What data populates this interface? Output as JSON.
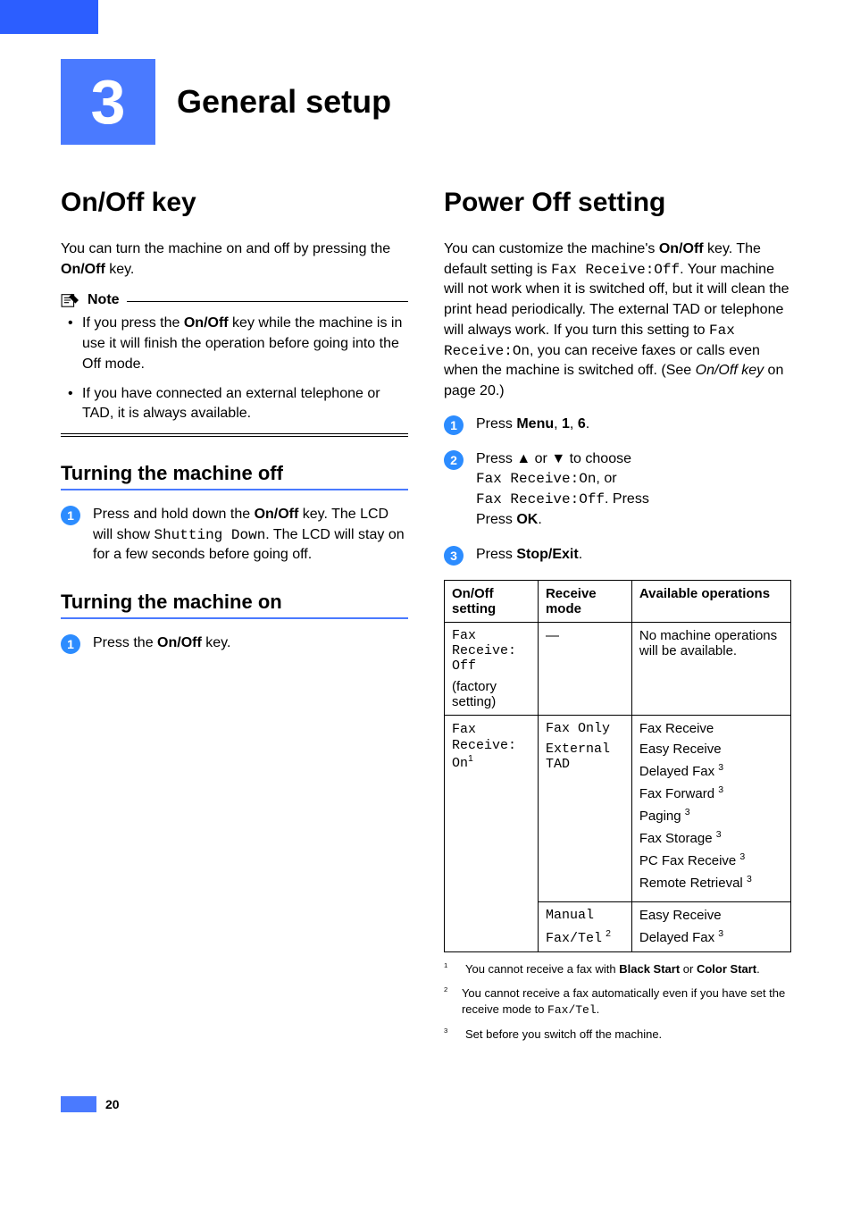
{
  "chapter": {
    "number": "3",
    "title": "General setup"
  },
  "left": {
    "h1": "On/Off key",
    "intro_pre": "You can turn the machine on and off by pressing the ",
    "intro_bold": "On/Off",
    "intro_post": " key.",
    "note_label": "Note",
    "note_items": {
      "a_pre": "If you press the ",
      "a_bold": "On/Off",
      "a_post": " key while the machine is in use it will finish the operation before going into the Off mode.",
      "b": "If you have connected an external telephone or TAD, it is always available."
    },
    "sub_off": "Turning the machine off",
    "off_step_pre": "Press and hold down the ",
    "off_step_bold": "On/Off",
    "off_step_mid": " key. The LCD will show ",
    "off_step_mono": "Shutting Down",
    "off_step_post": ". The LCD will stay on for a few seconds before going off.",
    "sub_on": "Turning the machine on",
    "on_step_pre": "Press the ",
    "on_step_bold": "On/Off",
    "on_step_post": " key."
  },
  "right": {
    "h1": "Power Off setting",
    "p1_a": "You can customize the machine's ",
    "p1_b": "On/Off",
    "p1_c": " key. The default setting is ",
    "p1_d": "Fax Receive:Off",
    "p1_e": ". Your machine will not work when it is switched off, but it will clean the print head periodically. The external TAD or telephone will always work. If you turn this setting to ",
    "p1_f": "Fax Receive:On",
    "p1_g": ", you can receive faxes or calls even when the machine is switched off. (See ",
    "p1_h": "On/Off key",
    "p1_i": " on page 20.)",
    "step1_a": "Press ",
    "step1_b": "Menu",
    "step1_c": ", ",
    "step1_d": "1",
    "step1_e": ", ",
    "step1_f": "6",
    "step1_g": ".",
    "step2_a": "Press ",
    "step2_tri1": "▲",
    "step2_b": " or ",
    "step2_tri2": "▼",
    "step2_c": " to choose ",
    "step2_d": "Fax Receive:On",
    "step2_e": ", or ",
    "step2_f": "Fax Receive:Off",
    "step2_g": ". Press ",
    "step2_h": "OK",
    "step2_i": ".",
    "step3_a": "Press ",
    "step3_b": "Stop/Exit",
    "step3_c": ".",
    "table": {
      "h1": "On/Off setting",
      "h2": "Receive mode",
      "h3": "Available operations",
      "r1c1a": "Fax Receive:",
      "r1c1b": "Off",
      "r1c1c": "(factory setting)",
      "r1c2": "—",
      "r1c3": "No machine operations will be available.",
      "r2c1a": "Fax Receive:",
      "r2c1b": "On",
      "r2c2a": "Fax Only",
      "r2c2b": "External TAD",
      "r2c3": {
        "a": "Fax Receive",
        "b": "Easy Receive",
        "c": "Delayed Fax",
        "d": "Fax Forward",
        "e": "Paging",
        "f": "Fax Storage",
        "g": "PC Fax Receive",
        "h": "Remote Retrieval"
      },
      "r3c2a": "Manual",
      "r3c2b": "Fax/Tel",
      "r3c3a": "Easy Receive",
      "r3c3b": "Delayed Fax"
    },
    "fn1_a": "You cannot receive a fax with ",
    "fn1_b": "Black Start",
    "fn1_c": " or ",
    "fn1_d": "Color Start",
    "fn1_e": ".",
    "fn2_a": "You cannot receive a fax automatically even if you have set the receive mode to ",
    "fn2_b": "Fax/Tel",
    "fn2_c": ".",
    "fn3": "Set before you switch off the machine."
  },
  "page_number": "20"
}
